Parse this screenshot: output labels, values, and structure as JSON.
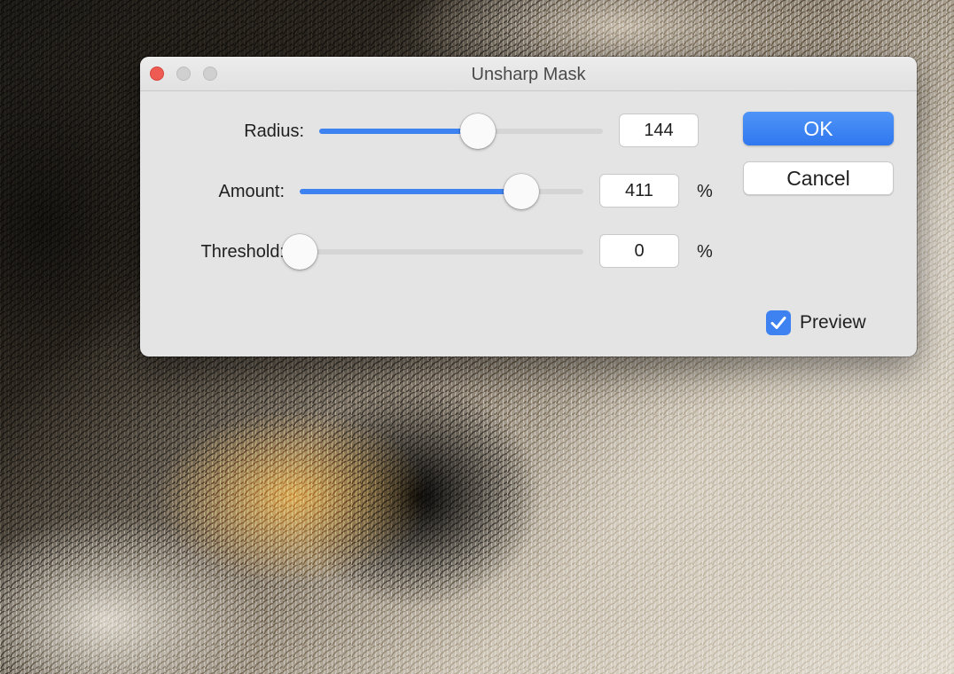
{
  "dialog": {
    "title": "Unsharp Mask",
    "controls": {
      "radius": {
        "label": "Radius:",
        "value": "144",
        "unit": "",
        "slider_fraction": 0.56
      },
      "amount": {
        "label": "Amount:",
        "value": "411",
        "unit": "%",
        "slider_fraction": 0.78
      },
      "threshold": {
        "label": "Threshold:",
        "value": "0",
        "unit": "%",
        "slider_fraction": 0.0
      }
    },
    "buttons": {
      "ok": "OK",
      "cancel": "Cancel"
    },
    "preview": {
      "label": "Preview",
      "checked": true
    }
  },
  "colors": {
    "accent": "#3d82f0",
    "close_button": "#ee5b52"
  },
  "icons": {
    "checkmark": "checkmark-icon"
  }
}
